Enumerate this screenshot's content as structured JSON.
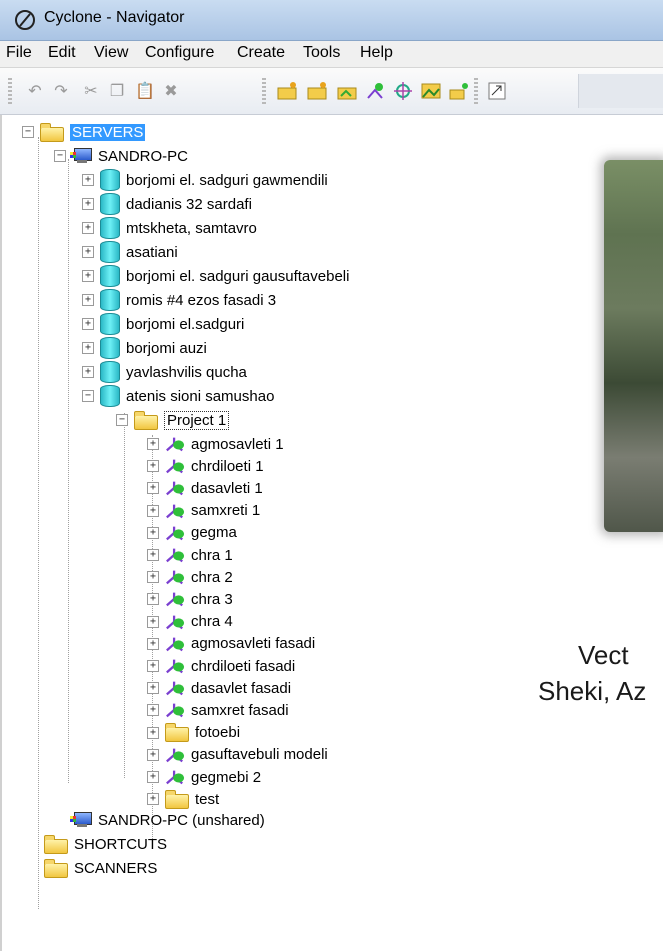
{
  "window": {
    "title": "Cyclone - Navigator"
  },
  "menu": [
    "File",
    "Edit",
    "View",
    "Configure",
    "Create",
    "Tools",
    "Help"
  ],
  "toolbar": {
    "buttons": [
      "undo-icon",
      "redo-icon",
      "cut-icon",
      "copy-icon",
      "paste-icon",
      "delete-icon",
      "new-folder-icon",
      "new-folder-2-icon",
      "new-folder-3-icon",
      "new-scan-icon",
      "new-target-icon",
      "new-image-icon",
      "new-item-icon",
      "properties-icon"
    ]
  },
  "tree": {
    "servers": "SERVERS",
    "host": "SANDRO-PC",
    "databases": [
      "borjomi el. sadguri gawmendili",
      "dadianis 32 sardafi",
      "mtskheta, samtavro",
      "asatiani",
      "borjomi el. sadguri gausuftavebeli",
      "romis #4 ezos fasadi 3",
      "borjomi el.sadguri",
      "borjomi auzi",
      "yavlashvilis qucha",
      "atenis sioni samushao"
    ],
    "project": "Project 1",
    "project_items": [
      {
        "label": "agmosavleti 1",
        "type": "scan"
      },
      {
        "label": "chrdiloeti 1",
        "type": "scan"
      },
      {
        "label": "dasavleti 1",
        "type": "scan"
      },
      {
        "label": "samxreti 1",
        "type": "scan"
      },
      {
        "label": "gegma",
        "type": "scan"
      },
      {
        "label": "chra 1",
        "type": "scan"
      },
      {
        "label": "chra 2",
        "type": "scan"
      },
      {
        "label": "chra 3",
        "type": "scan"
      },
      {
        "label": "chra 4",
        "type": "scan"
      },
      {
        "label": "agmosavleti fasadi",
        "type": "scan"
      },
      {
        "label": "chrdiloeti fasadi",
        "type": "scan"
      },
      {
        "label": "dasavlet fasadi",
        "type": "scan"
      },
      {
        "label": "samxret fasadi",
        "type": "scan"
      },
      {
        "label": "fotoebi",
        "type": "folder"
      },
      {
        "label": "gasuftavebuli modeli",
        "type": "scan"
      },
      {
        "label": "gegmebi 2",
        "type": "scan"
      },
      {
        "label": "test",
        "type": "folder"
      }
    ],
    "host_unshared": "SANDRO-PC (unshared)",
    "shortcuts": "SHORTCUTS",
    "scanners": "SCANNERS"
  },
  "slide": {
    "line1": "Vect",
    "line2": "Sheki, Az"
  }
}
